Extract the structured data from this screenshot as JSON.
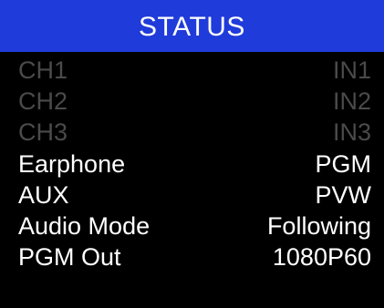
{
  "header": {
    "title": "STATUS",
    "background_color": "#1f3bd9",
    "text_color": "#ffffff"
  },
  "colors": {
    "active_text": "#ffffff",
    "dimmed_text": "#4a4a4a",
    "background": "#000000"
  },
  "rows": [
    {
      "label": "CH1",
      "value": "IN1",
      "dimmed": true
    },
    {
      "label": "CH2",
      "value": "IN2",
      "dimmed": true
    },
    {
      "label": "CH3",
      "value": "IN3",
      "dimmed": true
    },
    {
      "label": "Earphone",
      "value": "PGM",
      "dimmed": false
    },
    {
      "label": "AUX",
      "value": "PVW",
      "dimmed": false
    },
    {
      "label": "Audio Mode",
      "value": "Following",
      "dimmed": false
    },
    {
      "label": "PGM Out",
      "value": "1080P60",
      "dimmed": false
    }
  ]
}
